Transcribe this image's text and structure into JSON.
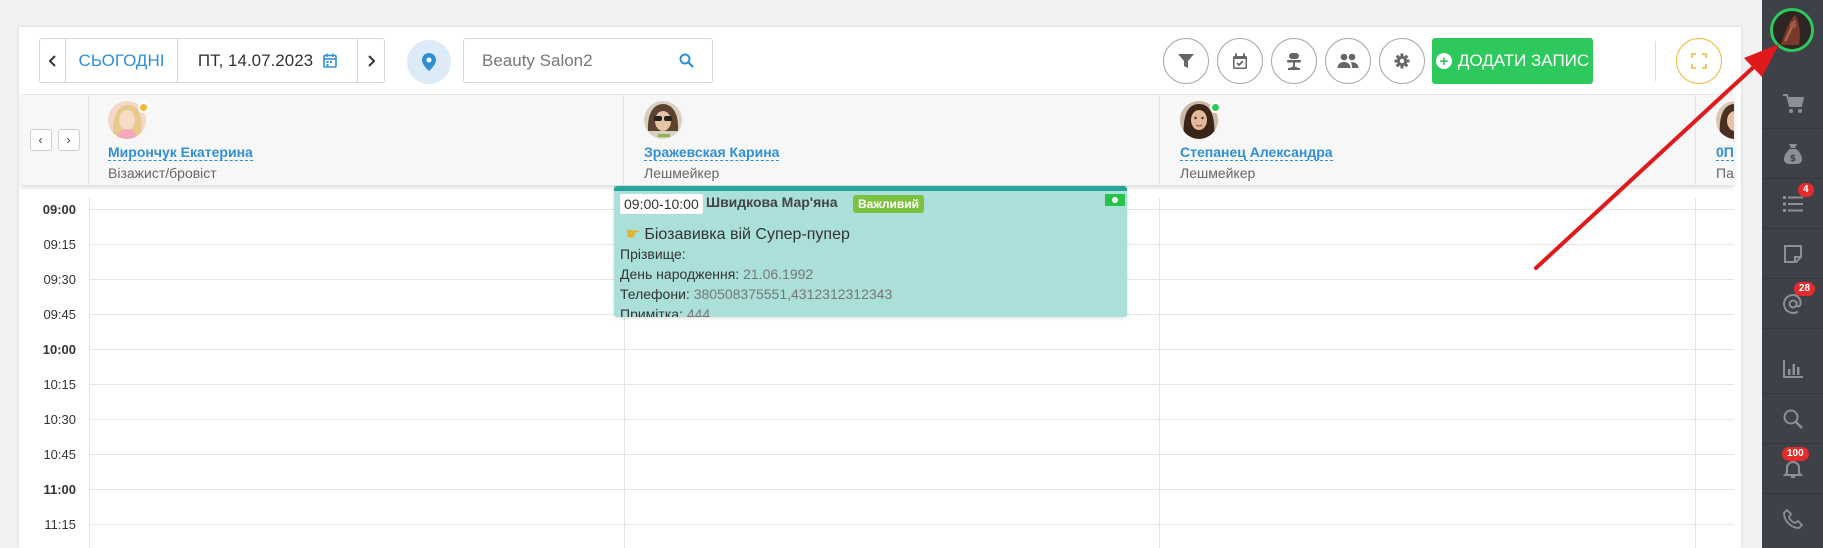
{
  "toolbar": {
    "prev_label": "‹",
    "today_label": "СЬОГОДНІ",
    "date_value": "ПТ, 14.07.2023",
    "next_label": "›",
    "salon_search_value": "Beauty Salon2",
    "add_button_label": "ДОДАТИ ЗАПИС",
    "icons": [
      "filter-icon",
      "calendar-check-icon",
      "chair-icon",
      "users-icon",
      "gear-icon"
    ]
  },
  "staff_nav": {
    "prev": "‹",
    "next": "›"
  },
  "staff": [
    {
      "name": "Мирончук Екатерина",
      "role": "Візажист/бровіст",
      "status_color": "#f5b82e"
    },
    {
      "name": "Зражевская Карина",
      "role": "Лешмейкер",
      "status_color": ""
    },
    {
      "name": "Степанец Александра",
      "role": "Лешмейкер",
      "status_color": "#2ec95c"
    },
    {
      "name": "0П",
      "role": "Па"
    }
  ],
  "time_slots": [
    "09:00",
    "09:15",
    "09:30",
    "09:45",
    "10:00",
    "10:15",
    "10:30",
    "10:45",
    "11:00",
    "11:15"
  ],
  "appointment": {
    "time": "09:00-10:00",
    "client": "Швидкова Мар'яна",
    "badge": "Важливий",
    "service": "Біозавивка вій Супер-пупер",
    "surname_label": "Прізвище:",
    "birthday_label": "День народження:",
    "birthday_value": "21.06.1992",
    "phones_label": "Телефони:",
    "phones_value": "380508375551,4312312312343",
    "note_label": "Примітка:",
    "note_value": "444"
  },
  "rail": {
    "items": [
      {
        "icon": "cart-icon"
      },
      {
        "icon": "money-bag-icon"
      },
      {
        "icon": "task-list-icon",
        "badge": "4"
      },
      {
        "icon": "note-icon"
      },
      {
        "icon": "at-sign-icon",
        "badge": "28"
      },
      {
        "icon": "chart-icon"
      },
      {
        "icon": "search-icon"
      },
      {
        "icon": "bell-icon",
        "badge": "100"
      },
      {
        "icon": "phone-icon"
      }
    ]
  },
  "colors": {
    "accent_blue": "#2f8fd5",
    "add_green": "#2ec95c",
    "appointment_bg": "#aadfda",
    "appointment_border": "#27a59b",
    "badge_green": "#7cc242",
    "rail_bg": "#3e4147",
    "annotation_arrow": "#e0191c"
  }
}
